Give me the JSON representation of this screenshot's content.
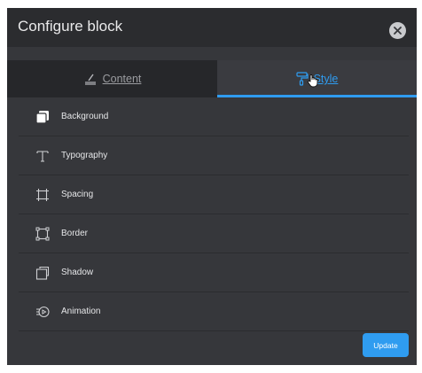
{
  "modal": {
    "title": "Configure block",
    "close_icon": "close-circle-icon"
  },
  "tabs": [
    {
      "label": "Content",
      "icon": "pen-underline-icon",
      "active": false
    },
    {
      "label": "Style",
      "icon": "paint-roller-icon",
      "active": true
    }
  ],
  "items": [
    {
      "label": "Background",
      "icon": "background-icon"
    },
    {
      "label": "Typography",
      "icon": "typography-icon"
    },
    {
      "label": "Spacing",
      "icon": "spacing-icon"
    },
    {
      "label": "Border",
      "icon": "border-icon"
    },
    {
      "label": "Shadow",
      "icon": "shadow-icon"
    },
    {
      "label": "Animation",
      "icon": "animation-icon"
    }
  ],
  "footer": {
    "update_label": "Update"
  },
  "colors": {
    "accent": "#2f9cf0",
    "panel": "#36373b",
    "header": "#2b2c2f"
  }
}
